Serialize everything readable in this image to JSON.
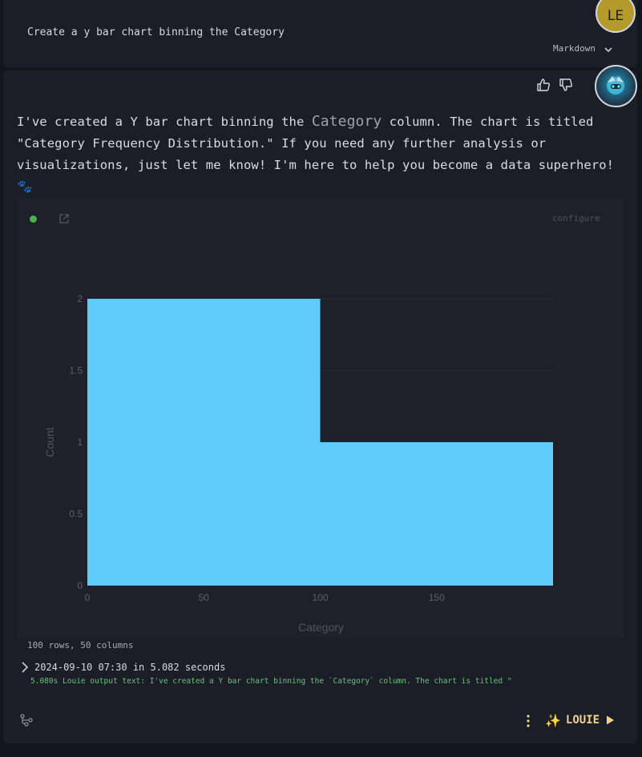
{
  "prompt_cell": {
    "text": "Create a y bar chart binning the Category",
    "mode_label": "Markdown",
    "user_initials": "LE"
  },
  "response": {
    "text_before": "I've created a Y bar chart binning the ",
    "code_term": "Category",
    "text_after": " column. The chart is titled \"Category Frequency Distribution.\" If you need any further analysis or visualizations, just let me know! I'm here to help you become a data superhero! 🐾"
  },
  "chart_panel": {
    "configure_label": "configure",
    "status_color": "#4caf50"
  },
  "chart_data": {
    "type": "bar",
    "bins": [
      {
        "x0": 0,
        "x1": 100,
        "count": 2
      },
      {
        "x0": 100,
        "x1": 200,
        "count": 1
      }
    ],
    "xlabel": "Category",
    "ylabel": "Count",
    "xlim": [
      0,
      200
    ],
    "ylim": [
      0,
      2
    ],
    "xticks": [
      "0",
      "50",
      "100",
      "150"
    ],
    "yticks": [
      "0",
      "0.5",
      "1",
      "1.5",
      "2"
    ],
    "bar_color": "#5ecbfb",
    "grid": true
  },
  "footer": {
    "data_info": "100 rows, 50 columns",
    "run_info": "2024-09-10 07:30 in 5.082 seconds",
    "log": "5.080s Louie output text: I've created a Y bar chart binning the `Category` column. The chart is titled \"Ca…",
    "agent_label": "LOUIE",
    "agent_icon": "sparkles-icon"
  },
  "colors": {
    "accent": "#f2d28f",
    "log_green": "#69c27a"
  }
}
